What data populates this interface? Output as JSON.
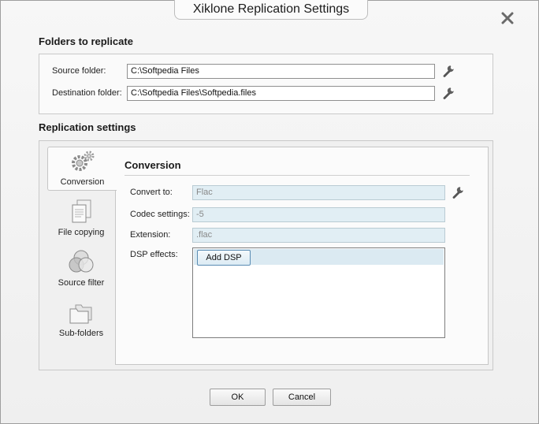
{
  "window": {
    "title": "Xiklone Replication Settings",
    "close_icon": "close-x-icon"
  },
  "folders": {
    "section_title": "Folders to replicate",
    "source_label": "Source folder:",
    "source_value": "C:\\Softpedia Files",
    "destination_label": "Destination folder:",
    "destination_value": "C:\\Softpedia Files\\Softpedia.files",
    "browse_icon": "wrench-icon"
  },
  "replication": {
    "section_title": "Replication settings",
    "tabs": [
      {
        "label": "Conversion",
        "icon": "gears-icon",
        "active": true
      },
      {
        "label": "File copying",
        "icon": "documents-icon",
        "active": false
      },
      {
        "label": "Source filter",
        "icon": "filter-circles-icon",
        "active": false
      },
      {
        "label": "Sub-folders",
        "icon": "folders-icon",
        "active": false
      }
    ],
    "conversion": {
      "title": "Conversion",
      "convert_to_label": "Convert to:",
      "convert_to_value": "Flac",
      "codec_label": "Codec settings:",
      "codec_value": "-5",
      "extension_label": "Extension:",
      "extension_value": ".flac",
      "dsp_label": "DSP effects:",
      "add_dsp_label": "Add DSP"
    }
  },
  "footer": {
    "ok_label": "OK",
    "cancel_label": "Cancel"
  },
  "colors": {
    "disabled_field": "#e1eef4",
    "selection": "#dbeaf2",
    "window_bg": "#f4f4f4"
  }
}
